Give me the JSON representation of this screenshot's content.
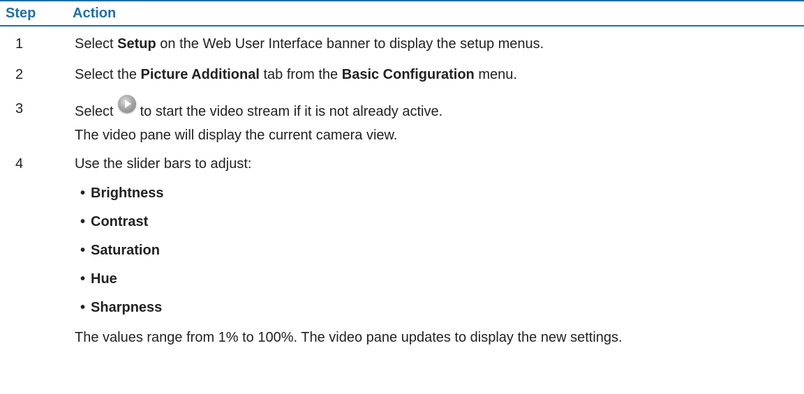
{
  "header": {
    "step_label": "Step",
    "action_label": "Action"
  },
  "steps": [
    {
      "num": "1",
      "pre": "Select ",
      "bold1": "Setup",
      "post": " on the Web User Interface banner to display the setup menus."
    },
    {
      "num": "2",
      "pre": "Select the ",
      "bold1": "Picture Additional",
      "mid": " tab from the ",
      "bold2": "Basic Configuration",
      "post": " menu."
    },
    {
      "num": "3",
      "pre": "Select",
      "icon": "play-icon",
      "post": "to start the video stream if it is not already active.",
      "note": "The video pane will display the current camera view."
    },
    {
      "num": "4",
      "text": "Use the slider bars to adjust:",
      "bullets": [
        "Brightness",
        "Contrast",
        "Saturation",
        "Hue",
        "Sharpness"
      ],
      "note": "The values range from 1% to 100%. The video pane updates to display the new settings."
    }
  ],
  "colors": {
    "accent": "#1f6fa8",
    "text": "#222222"
  }
}
